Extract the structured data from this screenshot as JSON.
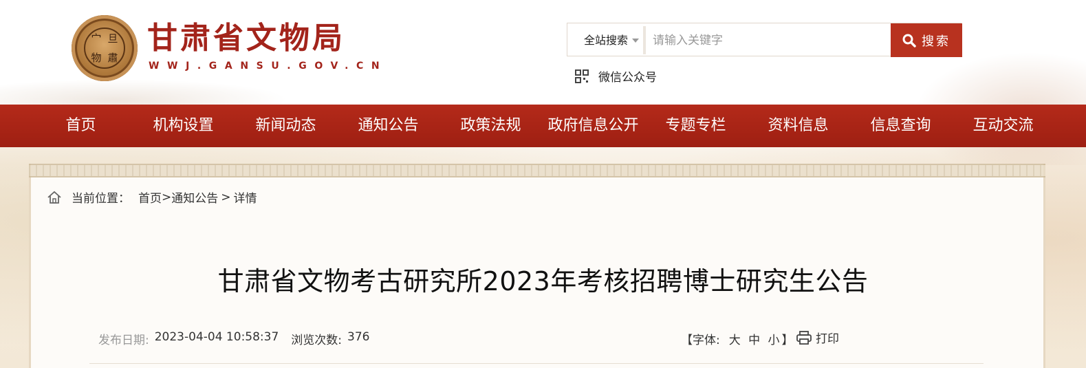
{
  "header": {
    "logo_chars": [
      "宀",
      "旦",
      "物",
      "肅"
    ],
    "brand": "甘肃省文物局",
    "url": "WWJ.GANSU.GOV.CN"
  },
  "search": {
    "scope": "全站搜索",
    "placeholder": "请输入关键字",
    "button": "搜索"
  },
  "wechat": {
    "label": "微信公众号"
  },
  "nav": {
    "items": [
      "首页",
      "机构设置",
      "新闻动态",
      "通知公告",
      "政策法规",
      "政府信息公开",
      "专题专栏",
      "资料信息",
      "信息查询",
      "互动交流"
    ]
  },
  "breadcrumb": {
    "prefix": "当前位置：",
    "home": "首页",
    "gt": ">",
    "section": "通知公告",
    "sep": ">",
    "current": "详情"
  },
  "article": {
    "title": "甘肃省文物考古研究所2023年考核招聘博士研究生公告",
    "date_label": "发布日期:",
    "date": "2023-04-04 10:58:37",
    "views_label": "浏览次数:",
    "views": "376",
    "font_open": "【字体:",
    "font_large": "大",
    "font_medium": "中",
    "font_small": "小",
    "font_close": "】",
    "print": "打印"
  },
  "colors": {
    "brand_red": "#a3241b",
    "nav_red": "#b42a1a",
    "button_red": "#b8321f"
  }
}
